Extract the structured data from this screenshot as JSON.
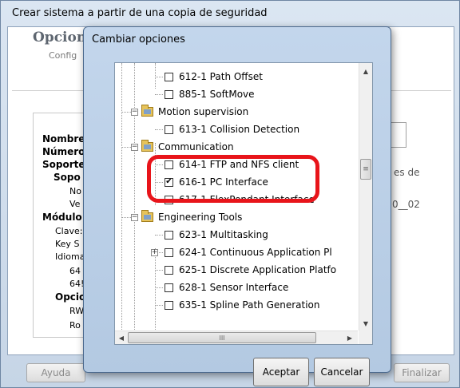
{
  "background_window": {
    "title": "Crear sistema a partir de una copia de seguridad",
    "heading": "Opcion",
    "subheading": "Config",
    "labels": [
      {
        "text": "Nombre",
        "bold": true
      },
      {
        "text": "Número",
        "bold": true
      },
      {
        "text": "Soporte",
        "bold": true
      },
      {
        "text": "Sopo",
        "bold": true
      },
      {
        "text": "No",
        "bold": false
      },
      {
        "text": "Ve",
        "bold": false
      },
      {
        "text": "Módulo",
        "bold": true
      },
      {
        "text": "Clave:",
        "bold": false
      },
      {
        "text": "Key S",
        "bold": false
      },
      {
        "text": "Idioma",
        "bold": false
      },
      {
        "text": "64",
        "bold": false
      },
      {
        "text": "64!",
        "bold": false
      },
      {
        "text": "Opcio",
        "bold": true
      },
      {
        "text": "RW",
        "bold": false
      },
      {
        "text": "Ro",
        "bold": false
      }
    ],
    "side_text_1": "es de",
    "side_text_2": "0__02",
    "buttons": {
      "help": "Ayuda",
      "finish": "Finalizar"
    }
  },
  "dialog": {
    "title": "Cambiar opciones",
    "tree": [
      {
        "type": "option",
        "code": "612-1 Path Offset",
        "checked": false
      },
      {
        "type": "option",
        "code": "885-1 SoftMove",
        "checked": false
      },
      {
        "type": "group",
        "label": "Motion supervision",
        "expanded": true
      },
      {
        "type": "option",
        "code": "613-1 Collision Detection",
        "checked": false
      },
      {
        "type": "group",
        "label": "Communication",
        "expanded": true
      },
      {
        "type": "option",
        "code": "614-1 FTP and NFS client",
        "checked": false
      },
      {
        "type": "option",
        "code": "616-1 PC Interface",
        "checked": true
      },
      {
        "type": "option",
        "code": "617-1 FlexPendant Interface",
        "checked": false
      },
      {
        "type": "group",
        "label": "Engineering Tools",
        "expanded": true
      },
      {
        "type": "option",
        "code": "623-1 Multitasking",
        "checked": false
      },
      {
        "type": "option",
        "code": "624-1 Continuous Application Pl",
        "checked": false,
        "has_children": true
      },
      {
        "type": "option",
        "code": "625-1 Discrete Application Platfo",
        "checked": false
      },
      {
        "type": "option",
        "code": "628-1 Sensor Interface",
        "checked": false
      },
      {
        "type": "option",
        "code": "635-1 Spline Path Generation",
        "checked": false
      }
    ],
    "buttons": {
      "accept": "Aceptar",
      "cancel": "Cancelar"
    },
    "scroll_glyphs": {
      "up": "▲",
      "down": "▼",
      "left": "◀",
      "right": "▶",
      "v_grip": "≡",
      "h_grip": "III"
    }
  },
  "colors": {
    "highlight": "#e8141a"
  }
}
